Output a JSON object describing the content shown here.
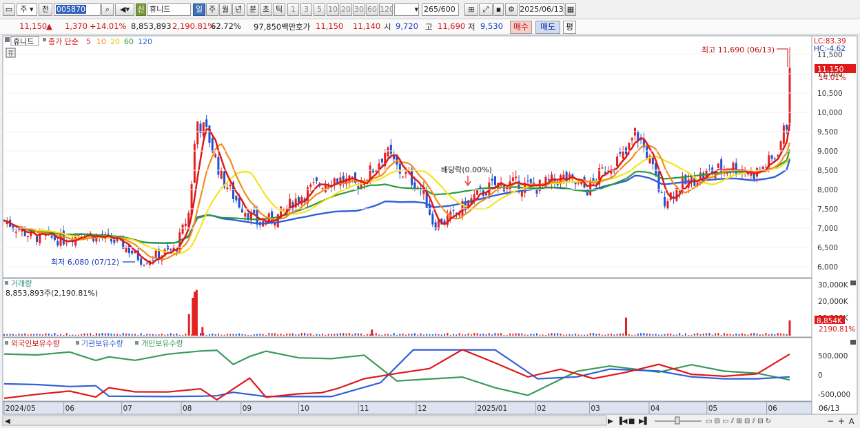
{
  "toolbar": {
    "market_dropdown": "주",
    "prev_label": "전",
    "code": "005870",
    "stock_name": "휴니드",
    "credit_badge": "신",
    "periods": [
      "일",
      "주",
      "월",
      "년",
      "분",
      "초",
      "틱"
    ],
    "intervals": [
      "1",
      "3",
      "5",
      "10",
      "20",
      "30",
      "60",
      "120"
    ],
    "count": "265",
    "count_max": "/600",
    "date": "2025/06/13"
  },
  "quote": {
    "price": "11,150",
    "change": "1,370",
    "change_pct": "+14.01%",
    "volume": "8,853,893",
    "volume_ratio": "2,190.81%",
    "turnover_ratio": "62.72%",
    "amount": "97,850백만",
    "ask_label": "호가",
    "ask": "11,150",
    "bid": "11,140",
    "open_label": "시",
    "open": "9,720",
    "high_label": "고",
    "high": "11,690",
    "low_label": "저",
    "low": "9,530",
    "buy_button": "매수",
    "sell_button": "매도",
    "eval_button": "평"
  },
  "legend": {
    "stock_name": "휴니드",
    "ma_title": "종가 단순",
    "ma_periods": [
      "5",
      "10",
      "20",
      "60",
      "120"
    ]
  },
  "indicators": {
    "lc": "LC:83.39",
    "hc": "HC:-4.62"
  },
  "annotations": {
    "high_label": "최고 11,690 (06/13)",
    "low_label": "최저 6,080 (07/12)",
    "dividend_label": "배당락(0.00%)",
    "last_price": "11,150",
    "last_pct": "14.01%"
  },
  "volume_panel": {
    "title": "거래량",
    "info": "8,853,893주(2,190.81%)",
    "last_label": "8,854K",
    "last_pct": "2190.81%",
    "ticks": [
      "30,000K",
      "20,000K",
      "10,000K"
    ]
  },
  "holdings_panel": {
    "series_labels": [
      "외국인보유수량",
      "기관보유수량",
      "개인보유수량"
    ],
    "ticks": [
      "500,000",
      "0",
      "-500,000"
    ]
  },
  "x_axis": [
    "2024/05",
    "06",
    "07",
    "08",
    "09",
    "10",
    "11",
    "12",
    "2025/01",
    "02",
    "03",
    "04",
    "05",
    "06",
    "06/13"
  ],
  "colors": {
    "candle_up": "#e32020",
    "candle_down": "#2050d0",
    "ma5": "#e01818",
    "ma10": "#f08c1a",
    "ma20": "#f5e31a",
    "ma60": "#2a9a3a",
    "ma120": "#2f5fd8",
    "foreign": "#e01818",
    "institution": "#2f5fd8",
    "individual": "#3a9a5a"
  },
  "chart_data": {
    "type": "candlestick",
    "y_ticks": [
      6000,
      6500,
      7000,
      7500,
      8000,
      8500,
      9000,
      9500,
      10000,
      10500,
      11000,
      11500
    ],
    "ylim": [
      5700,
      12000
    ],
    "close_path": [
      [
        "2024/05",
        7200
      ],
      [
        "2024/05/15",
        6800
      ],
      [
        "2024/06",
        6700
      ],
      [
        "2024/06/10",
        6900
      ],
      [
        "2024/06/20",
        6750
      ],
      [
        "2024/07",
        6600
      ],
      [
        "2024/07/12",
        6150
      ],
      [
        "2024/07/20",
        6300
      ],
      [
        "2024/07/29",
        6450
      ],
      [
        "2024/08/05",
        7400
      ],
      [
        "2024/08/09",
        9800
      ],
      [
        "2024/08/15",
        9400
      ],
      [
        "2024/08/22",
        8300
      ],
      [
        "2024/08/30",
        7700
      ],
      [
        "2024/09/10",
        7100
      ],
      [
        "2024/09/20",
        7300
      ],
      [
        "2024/10/01",
        7800
      ],
      [
        "2024/10/10",
        8100
      ],
      [
        "2024/10/20",
        8300
      ],
      [
        "2024/10/31",
        8100
      ],
      [
        "2024/11/10",
        8600
      ],
      [
        "2024/11/15",
        9000
      ],
      [
        "2024/11/22",
        8500
      ],
      [
        "2024/11/30",
        8200
      ],
      [
        "2024/12/05",
        7900
      ],
      [
        "2024/12/10",
        7100
      ],
      [
        "2024/12/20",
        7300
      ],
      [
        "2024/12/31",
        7800
      ],
      [
        "2025/01/10",
        8100
      ],
      [
        "2025/01/20",
        8150
      ],
      [
        "2025/02/01",
        8050
      ],
      [
        "2025/02/15",
        8300
      ],
      [
        "2025/02/28",
        8000
      ],
      [
        "2025/03/10",
        8600
      ],
      [
        "2025/03/20",
        8900
      ],
      [
        "2025/03/25",
        9500
      ],
      [
        "2025/04/01",
        8800
      ],
      [
        "2025/04/08",
        7700
      ],
      [
        "2025/04/15",
        8000
      ],
      [
        "2025/04/25",
        8300
      ],
      [
        "2025/05/05",
        8500
      ],
      [
        "2025/05/15",
        8600
      ],
      [
        "2025/05/25",
        8400
      ],
      [
        "2025/06/05",
        8800
      ],
      [
        "2025/06/12",
        9780
      ],
      [
        "2025/06/13",
        11150
      ]
    ],
    "ohlc_last": {
      "date": "2025/06/13",
      "open": 9720,
      "high": 11690,
      "low": 9530,
      "close": 11150
    },
    "extremes": {
      "high": {
        "date": "2025/06/13",
        "value": 11690
      },
      "low": {
        "date": "2024/07/12",
        "value": 6080
      }
    },
    "volume": [
      {
        "date": "2024/08/05",
        "value": 12500
      },
      {
        "date": "2024/08/07",
        "value": 22000
      },
      {
        "date": "2024/08/08",
        "value": 25500
      },
      {
        "date": "2024/08/09",
        "value": 26500
      },
      {
        "date": "2024/08/12",
        "value": 5000
      },
      {
        "date": "2024/11/08",
        "value": 3500
      },
      {
        "date": "2025/03/20",
        "value": 10500
      },
      {
        "date": "2025/06/13",
        "value": 8854
      }
    ],
    "holdings": {
      "foreign": [
        [
          0,
          -520000
        ],
        [
          10,
          -480000
        ],
        [
          20,
          -420000
        ],
        [
          28,
          -500000
        ],
        [
          32,
          -350000
        ],
        [
          40,
          -450000
        ],
        [
          50,
          -470000
        ],
        [
          60,
          -480000
        ],
        [
          65,
          -520000
        ],
        [
          75,
          -200000
        ],
        [
          80,
          -500000
        ],
        [
          90,
          -480000
        ],
        [
          97,
          -550000
        ],
        [
          102,
          -420000
        ],
        [
          110,
          -100000
        ],
        [
          120,
          -50000
        ],
        [
          130,
          200000
        ],
        [
          140,
          600000
        ],
        [
          150,
          300000
        ],
        [
          160,
          -50000
        ],
        [
          170,
          100000
        ],
        [
          180,
          -100000
        ],
        [
          190,
          0
        ],
        [
          200,
          150000
        ],
        [
          210,
          50000
        ],
        [
          220,
          -100000
        ],
        [
          230,
          100000
        ],
        [
          240,
          500000
        ]
      ],
      "institution": [
        [
          0,
          -230000
        ],
        [
          10,
          -250000
        ],
        [
          20,
          -300000
        ],
        [
          28,
          -280000
        ],
        [
          32,
          -550000
        ],
        [
          50,
          -560000
        ],
        [
          60,
          -550000
        ],
        [
          65,
          -540000
        ],
        [
          70,
          -450000
        ],
        [
          80,
          -560000
        ],
        [
          100,
          -560000
        ],
        [
          115,
          -200000
        ],
        [
          125,
          650000
        ],
        [
          150,
          650000
        ],
        [
          163,
          -100000
        ],
        [
          175,
          -50000
        ],
        [
          185,
          150000
        ],
        [
          200,
          100000
        ],
        [
          210,
          -50000
        ],
        [
          220,
          -100000
        ],
        [
          230,
          -100000
        ],
        [
          240,
          -50000
        ]
      ],
      "individual": [
        [
          0,
          500000
        ],
        [
          10,
          450000
        ],
        [
          20,
          500000
        ],
        [
          28,
          480000
        ],
        [
          32,
          520000
        ],
        [
          40,
          500000
        ],
        [
          50,
          550000
        ],
        [
          60,
          500000
        ],
        [
          65,
          550000
        ],
        [
          70,
          300000
        ],
        [
          75,
          500000
        ],
        [
          80,
          500000
        ],
        [
          90,
          450000
        ],
        [
          100,
          500000
        ],
        [
          110,
          400000
        ],
        [
          120,
          -100000
        ],
        [
          140,
          -150000
        ],
        [
          150,
          -300000
        ],
        [
          160,
          -500000
        ],
        [
          175,
          200000
        ],
        [
          185,
          150000
        ],
        [
          200,
          100000
        ],
        [
          210,
          300000
        ],
        [
          220,
          0
        ],
        [
          230,
          -50000
        ],
        [
          240,
          -80000
        ]
      ]
    }
  }
}
